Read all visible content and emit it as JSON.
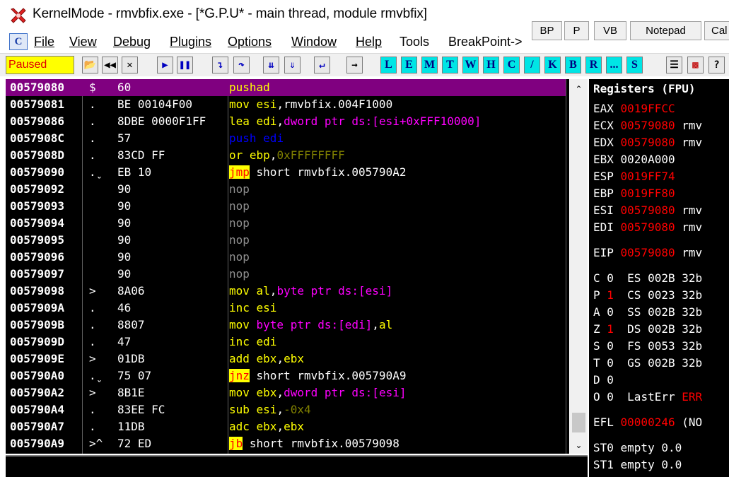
{
  "window": {
    "title": "KernelMode - rmvbfix.exe - [*G.P.U* - main thread, module rmvbfix]"
  },
  "menu": {
    "items": [
      "File",
      "View",
      "Debug",
      "Plugins",
      "Options",
      "Window",
      "Help",
      "Tools",
      "BreakPoint->"
    ],
    "c_button": "C"
  },
  "quick_buttons": [
    "BP",
    "P",
    "VB",
    "Notepad",
    "Cal"
  ],
  "toolbar": {
    "status": "Paused",
    "letters": [
      "L",
      "E",
      "M",
      "T",
      "W",
      "H",
      "C",
      "/",
      "K",
      "B",
      "R",
      "...",
      "S"
    ]
  },
  "disasm": [
    {
      "addr": "00579080",
      "mark": "$",
      "hex": "60",
      "asm": [
        [
          "pushad",
          "m"
        ]
      ],
      "selected": true
    },
    {
      "addr": "00579081",
      "mark": ".",
      "hex": "BE 00104F00",
      "asm": [
        [
          "mov ",
          "m"
        ],
        [
          "esi",
          "m"
        ],
        [
          ",rmvbfix.004F1000",
          "wh"
        ]
      ]
    },
    {
      "addr": "00579086",
      "mark": ".",
      "hex": "8DBE 0000F1FF",
      "asm": [
        [
          "lea ",
          "m"
        ],
        [
          "edi",
          "m"
        ],
        [
          ",",
          "wh"
        ],
        [
          "dword ptr ds:[esi+0xFFF10000]",
          "mg"
        ]
      ]
    },
    {
      "addr": "0057908C",
      "mark": ".",
      "hex": "57",
      "asm": [
        [
          "push ",
          "bl"
        ],
        [
          "edi",
          "bl"
        ]
      ]
    },
    {
      "addr": "0057908D",
      "mark": ".",
      "hex": "83CD FF",
      "asm": [
        [
          "or ",
          "m"
        ],
        [
          "ebp",
          "m"
        ],
        [
          ",",
          "wh"
        ],
        [
          "0xFFFFFFFF",
          "num"
        ]
      ]
    },
    {
      "addr": "00579090",
      "mark": ".ˬ",
      "hex": "EB 10",
      "asm": [
        [
          "jmp",
          "jmp"
        ],
        [
          " short rmvbfix.005790A2",
          "wh"
        ]
      ]
    },
    {
      "addr": "00579092",
      "mark": "",
      "hex": "90",
      "asm": [
        [
          "nop",
          "nop"
        ]
      ]
    },
    {
      "addr": "00579093",
      "mark": "",
      "hex": "90",
      "asm": [
        [
          "nop",
          "nop"
        ]
      ]
    },
    {
      "addr": "00579094",
      "mark": "",
      "hex": "90",
      "asm": [
        [
          "nop",
          "nop"
        ]
      ]
    },
    {
      "addr": "00579095",
      "mark": "",
      "hex": "90",
      "asm": [
        [
          "nop",
          "nop"
        ]
      ]
    },
    {
      "addr": "00579096",
      "mark": "",
      "hex": "90",
      "asm": [
        [
          "nop",
          "nop"
        ]
      ]
    },
    {
      "addr": "00579097",
      "mark": "",
      "hex": "90",
      "asm": [
        [
          "nop",
          "nop"
        ]
      ]
    },
    {
      "addr": "00579098",
      "mark": ">",
      "hex": "8A06",
      "asm": [
        [
          "mov ",
          "m"
        ],
        [
          "al",
          "m"
        ],
        [
          ",",
          "wh"
        ],
        [
          "byte ptr ds:[esi]",
          "mg"
        ]
      ]
    },
    {
      "addr": "0057909A",
      "mark": ".",
      "hex": "46",
      "asm": [
        [
          "inc ",
          "m"
        ],
        [
          "esi",
          "m"
        ]
      ]
    },
    {
      "addr": "0057909B",
      "mark": ".",
      "hex": "8807",
      "asm": [
        [
          "mov ",
          "m"
        ],
        [
          "byte ptr ds:[edi]",
          "mg"
        ],
        [
          ",",
          "wh"
        ],
        [
          "al",
          "m"
        ]
      ]
    },
    {
      "addr": "0057909D",
      "mark": ".",
      "hex": "47",
      "asm": [
        [
          "inc ",
          "m"
        ],
        [
          "edi",
          "m"
        ]
      ]
    },
    {
      "addr": "0057909E",
      "mark": ">",
      "hex": "01DB",
      "asm": [
        [
          "add ",
          "m"
        ],
        [
          "ebx",
          "m"
        ],
        [
          ",",
          "wh"
        ],
        [
          "ebx",
          "m"
        ]
      ]
    },
    {
      "addr": "005790A0",
      "mark": ".ˬ",
      "hex": "75 07",
      "asm": [
        [
          "jnz",
          "jmp"
        ],
        [
          " short rmvbfix.005790A9",
          "wh"
        ]
      ]
    },
    {
      "addr": "005790A2",
      "mark": ">",
      "hex": "8B1E",
      "asm": [
        [
          "mov ",
          "m"
        ],
        [
          "ebx",
          "m"
        ],
        [
          ",",
          "wh"
        ],
        [
          "dword ptr ds:[esi]",
          "mg"
        ]
      ]
    },
    {
      "addr": "005790A4",
      "mark": ".",
      "hex": "83EE FC",
      "asm": [
        [
          "sub ",
          "m"
        ],
        [
          "esi",
          "m"
        ],
        [
          ",",
          "wh"
        ],
        [
          "-0x4",
          "num"
        ]
      ]
    },
    {
      "addr": "005790A7",
      "mark": ".",
      "hex": "11DB",
      "asm": [
        [
          "adc ",
          "m"
        ],
        [
          "ebx",
          "m"
        ],
        [
          ",",
          "wh"
        ],
        [
          "ebx",
          "m"
        ]
      ]
    },
    {
      "addr": "005790A9",
      "mark": ">^",
      "hex": "72 ED",
      "asm": [
        [
          "jb",
          "jmp"
        ],
        [
          " short rmvbfix.00579098",
          "wh"
        ]
      ]
    }
  ],
  "registers": {
    "title": "Registers (FPU)",
    "rows": [
      {
        "name": "EAX",
        "value": "0019FFCC",
        "extra": "",
        "red": true
      },
      {
        "name": "ECX",
        "value": "00579080",
        "extra": " rmv",
        "red": true
      },
      {
        "name": "EDX",
        "value": "00579080",
        "extra": " rmv",
        "red": true
      },
      {
        "name": "EBX",
        "value": "0020A000",
        "extra": "",
        "red": false
      },
      {
        "name": "ESP",
        "value": "0019FF74",
        "extra": "",
        "red": true
      },
      {
        "name": "EBP",
        "value": "0019FF80",
        "extra": "",
        "red": true
      },
      {
        "name": "ESI",
        "value": "00579080",
        "extra": " rmv",
        "red": true
      },
      {
        "name": "EDI",
        "value": "00579080",
        "extra": " rmv",
        "red": true
      },
      {
        "name": "EIP",
        "value": "00579080",
        "extra": " rmv",
        "red": true
      }
    ],
    "flags": [
      {
        "flag": "C",
        "val": "0",
        "red": false,
        "seg": "ES",
        "segval": "002B",
        "bits": "32b"
      },
      {
        "flag": "P",
        "val": "1",
        "red": true,
        "seg": "CS",
        "segval": "0023",
        "bits": "32b"
      },
      {
        "flag": "A",
        "val": "0",
        "red": false,
        "seg": "SS",
        "segval": "002B",
        "bits": "32b"
      },
      {
        "flag": "Z",
        "val": "1",
        "red": true,
        "seg": "DS",
        "segval": "002B",
        "bits": "32b"
      },
      {
        "flag": "S",
        "val": "0",
        "red": false,
        "seg": "FS",
        "segval": "0053",
        "bits": "32b"
      },
      {
        "flag": "T",
        "val": "0",
        "red": false,
        "seg": "GS",
        "segval": "002B",
        "bits": "32b"
      },
      {
        "flag": "D",
        "val": "0",
        "red": false,
        "seg": "",
        "segval": "",
        "bits": ""
      },
      {
        "flag": "O",
        "val": "0",
        "red": false,
        "seg": "LastErr",
        "segval": "ERR",
        "bits": ""
      }
    ],
    "efl": {
      "name": "EFL",
      "value": "00000246",
      "extra": " (NO"
    },
    "fpu": [
      {
        "name": "ST0",
        "value": "empty 0.0"
      },
      {
        "name": "ST1",
        "value": "empty 0.0"
      }
    ]
  }
}
